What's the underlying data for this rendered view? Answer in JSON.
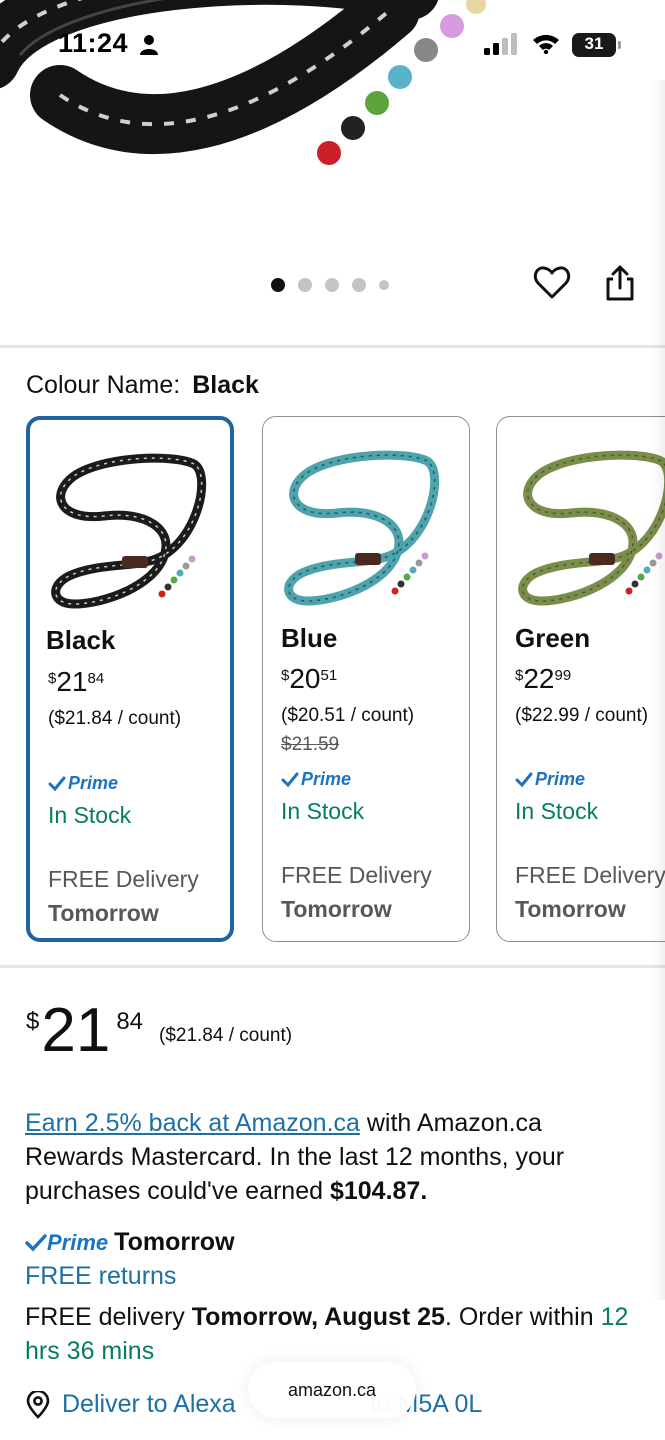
{
  "status_bar": {
    "time": "11:24",
    "battery": "31",
    "icons": [
      "person-icon",
      "signal-icon",
      "wifi-icon",
      "battery-icon"
    ]
  },
  "gallery": {
    "image_count": 5,
    "active_index": 0,
    "icons": [
      "heart-icon",
      "share-icon"
    ]
  },
  "colour": {
    "label": "Colour Name:",
    "selected": "Black"
  },
  "swatches": [
    {
      "name": "Black",
      "price_symbol": "$",
      "price_whole": "21",
      "price_fraction": "84",
      "per_count": "($21.84 / count)",
      "was_price": "",
      "prime": "Prime",
      "stock": "In Stock",
      "delivery": "FREE Delivery",
      "delivery_day": "Tomorrow",
      "leash_color": "#1b1b1b",
      "stripe_color": "#c8c8c8"
    },
    {
      "name": "Blue",
      "price_symbol": "$",
      "price_whole": "20",
      "price_fraction": "51",
      "per_count": "($20.51 / count)",
      "was_price": "$21.59",
      "prime": "Prime",
      "stock": "In Stock",
      "delivery": "FREE Delivery",
      "delivery_day": "Tomorrow",
      "leash_color": "#4fa3ad",
      "stripe_color": "#1e5a66"
    },
    {
      "name": "Green",
      "price_symbol": "$",
      "price_whole": "22",
      "price_fraction": "99",
      "per_count": "($22.99 / count)",
      "was_price": "",
      "prime": "Prime",
      "stock": "In Stock",
      "delivery": "FREE Delivery",
      "delivery_day": "Tomorrow",
      "leash_color": "#7a8e4c",
      "stripe_color": "#4a5a2a"
    }
  ],
  "price": {
    "symbol": "$",
    "whole": "21",
    "fraction": "84",
    "per_count": "($21.84 / count)"
  },
  "rewards": {
    "link": "Earn 2.5% back at Amazon.ca",
    "text": " with Amazon.ca Rewards Mastercard. In the last 12 months, your purchases could've earned ",
    "amount": "$104.87."
  },
  "delivery": {
    "prime_label": "Prime",
    "prime_day": "Tomorrow",
    "free_returns": "FREE returns",
    "free_delivery_prefix": "FREE delivery ",
    "free_delivery_date": "Tomorrow, August 25",
    "order_within_prefix": ". Order within ",
    "countdown": "12 hrs 36 mins"
  },
  "deliver_to": {
    "text": "Deliver to Alexa",
    "text_tail": "to M5A 0L"
  },
  "browser": {
    "url": "amazon.ca"
  },
  "colors": {
    "selected_border": "#2162a1",
    "link_blue": "#1d6fa5",
    "prime_blue": "#1e73be",
    "stock_green": "#067d62",
    "muted_text": "#565959"
  }
}
